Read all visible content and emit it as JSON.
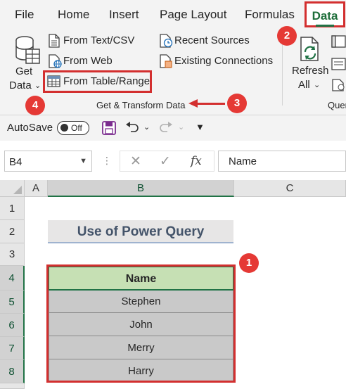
{
  "menu": {
    "items": [
      "File",
      "Home",
      "Insert",
      "Page Layout",
      "Formulas"
    ],
    "active": "Data"
  },
  "ribbon": {
    "get_data_line1": "Get",
    "get_data_line2": "Data",
    "from_text_csv": "From Text/CSV",
    "from_web": "From Web",
    "from_table_range": "From Table/Range",
    "recent_sources": "Recent Sources",
    "existing_connections": "Existing Connections",
    "refresh_line1": "Refresh",
    "refresh_line2": "All",
    "group_label": "Get & Transform Data",
    "next_group_label": "Quer"
  },
  "badges": {
    "b1": "1",
    "b2": "2",
    "b3": "3",
    "b4": "4"
  },
  "qat": {
    "autosave_label": "AutoSave",
    "toggle_state": "Off"
  },
  "formula_bar": {
    "name_box": "B4",
    "fx_label": "fx",
    "value": "Name"
  },
  "sheet": {
    "columns": [
      "A",
      "B",
      "C"
    ],
    "rows": [
      "1",
      "2",
      "3",
      "4",
      "5",
      "6",
      "7",
      "8"
    ],
    "title": "Use of Power Query",
    "table_header": "Name",
    "table_rows": [
      "Stephen",
      "John",
      "Merry",
      "Harry"
    ]
  },
  "colors": {
    "accent_green": "#217346",
    "highlight_red": "#d32f2f",
    "header_fill": "#c6e0b4",
    "row_fill": "#c9c9c9"
  }
}
